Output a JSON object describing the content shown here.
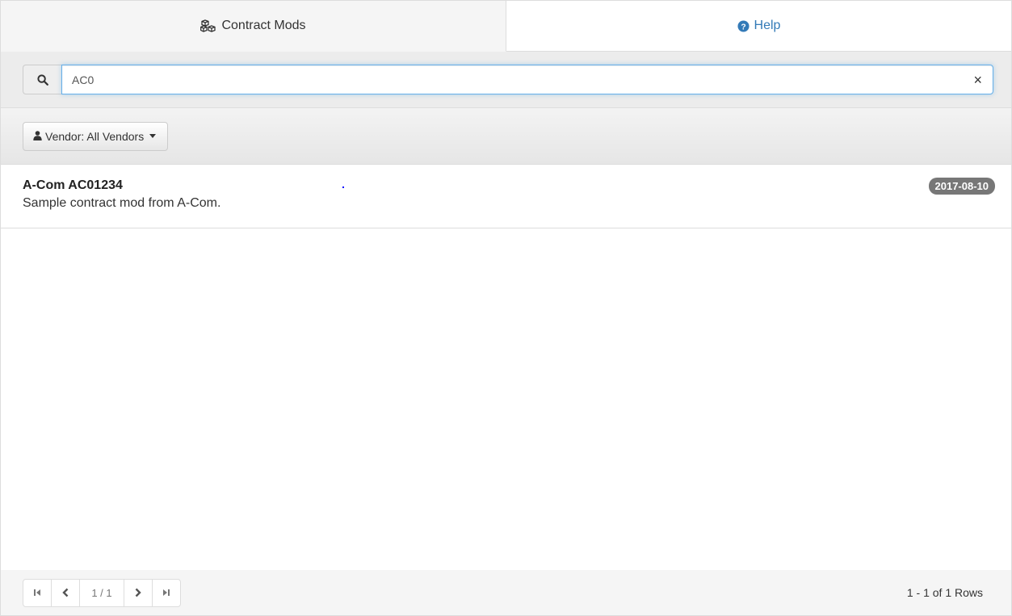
{
  "tabs": [
    {
      "label": "Contract Mods",
      "icon": "cubes-icon",
      "active": true
    },
    {
      "label": "Help",
      "icon": "question-circle-icon",
      "active": false
    }
  ],
  "search": {
    "value": "AC0",
    "icon": "search-icon",
    "clear_label": "×"
  },
  "filter": {
    "vendor_label": "Vendor: All Vendors",
    "icon": "user-icon"
  },
  "results": [
    {
      "title": "A-Com AC01234",
      "description": "Sample contract mod from A-Com.",
      "date": "2017-08-10"
    }
  ],
  "pagination": {
    "page_info": "1 / 1",
    "rows_info": "1 - 1 of 1 Rows"
  },
  "colors": {
    "accent": "#337ab7",
    "badge": "#777777",
    "focus_border": "#66afe9"
  }
}
